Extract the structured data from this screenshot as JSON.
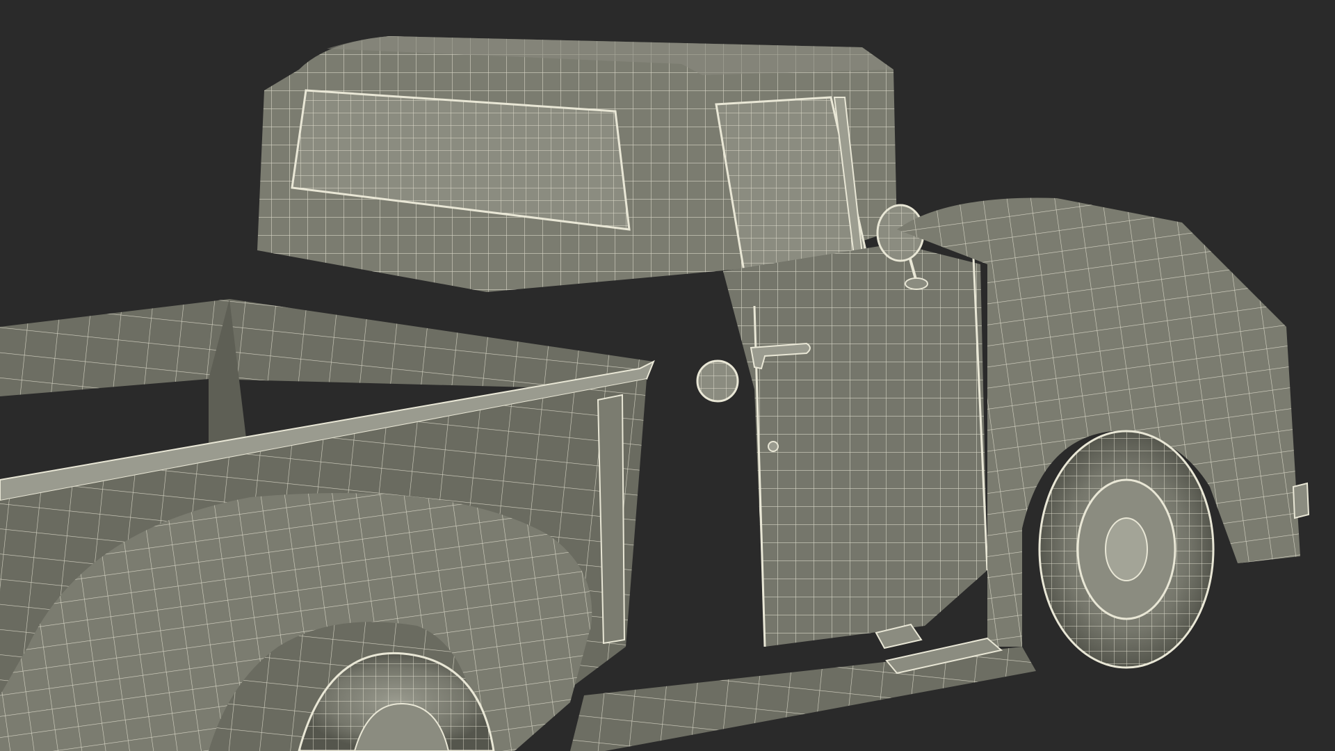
{
  "scene": {
    "subject": "pickup-truck-wireframe-render",
    "colors": {
      "background": "#2a2a2a",
      "body_fill": "#7b7c70",
      "body_shadow": "#5e5f55",
      "body_dark": "#4a4b43",
      "wire": "#e9e7d6",
      "glass": "#8b8c80",
      "tire": "#6f7066"
    }
  }
}
